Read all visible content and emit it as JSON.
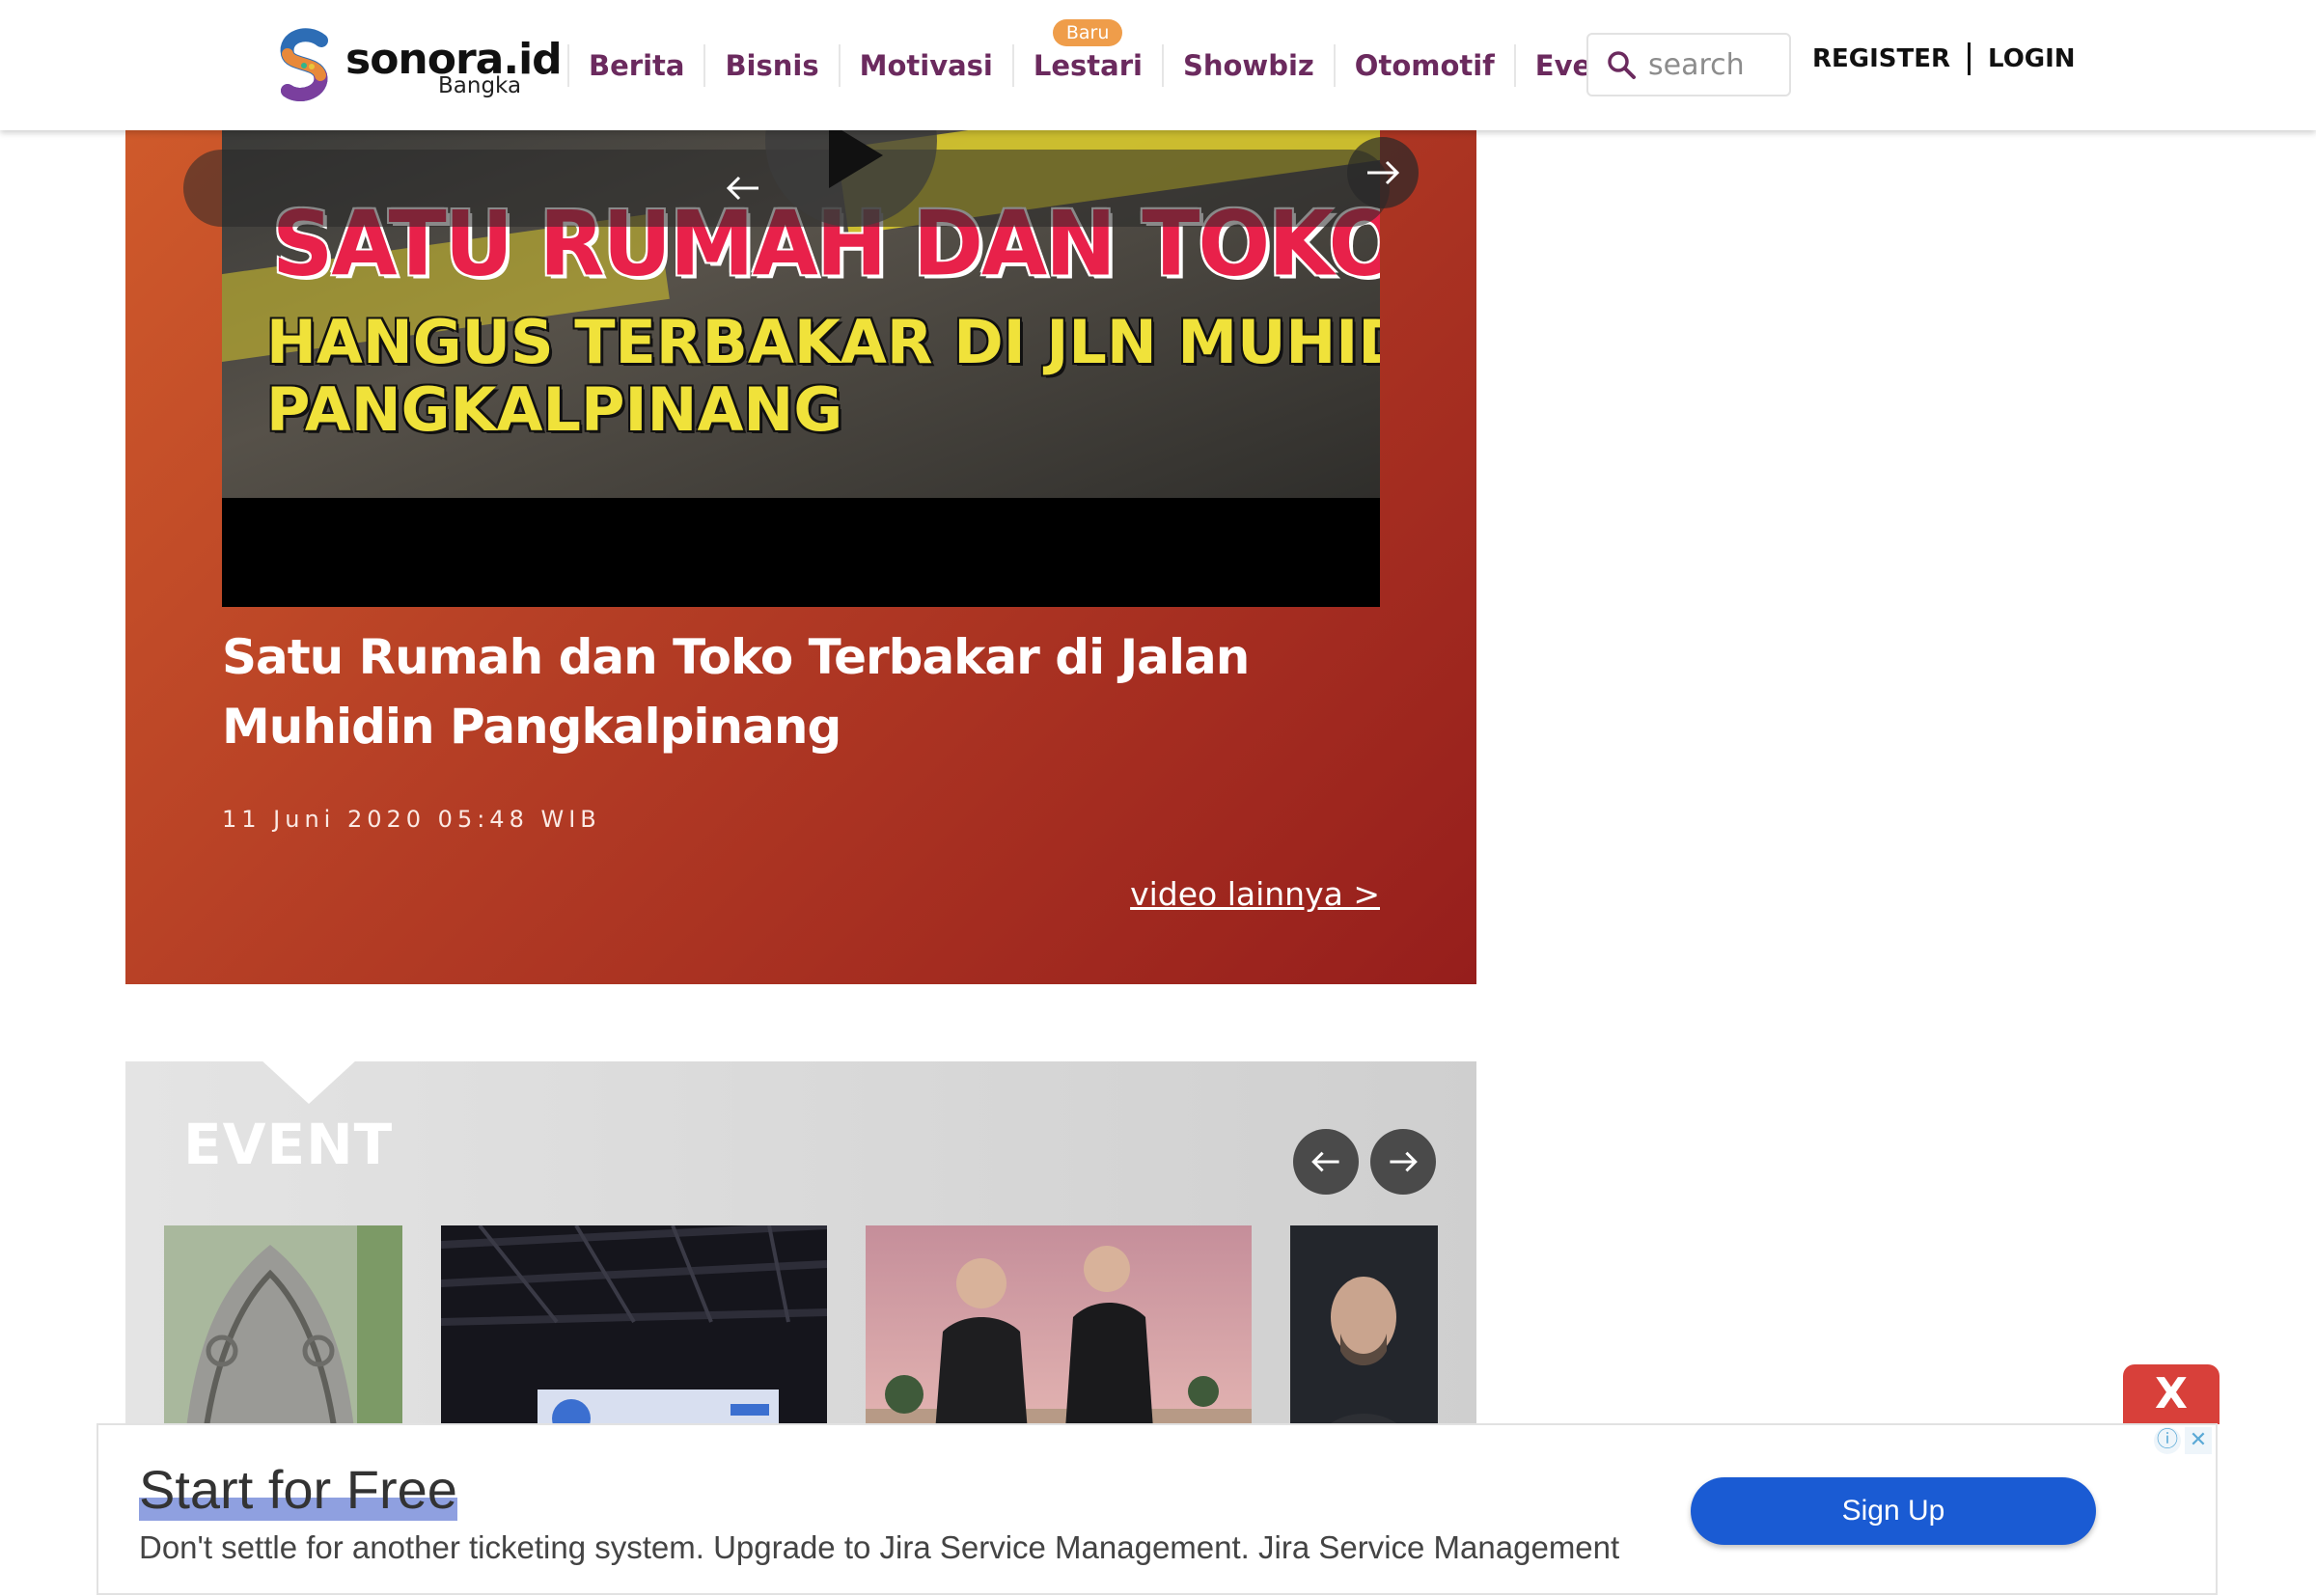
{
  "header": {
    "logo_text": "sonora.id",
    "logo_sub": "Bangka",
    "nav": [
      {
        "label": "Berita"
      },
      {
        "label": "Bisnis"
      },
      {
        "label": "Motivasi"
      },
      {
        "label": "Lestari",
        "badge": "Baru"
      },
      {
        "label": "Showbiz"
      },
      {
        "label": "Otomotif"
      },
      {
        "label": "Events"
      }
    ],
    "search_placeholder": "search",
    "register_label": "REGISTER",
    "login_label": "LOGIN"
  },
  "video": {
    "thumb_line1": "SATU RUMAH DAN TOKO",
    "thumb_line2": "HANGUS TERBAKAR DI JLN MUHIDIN",
    "thumb_line3": "PANGKALPINANG",
    "title": "Satu Rumah dan Toko Terbakar di Jalan Muhidin Pangkalpinang",
    "date": "11 Juni 2020 05:48 WIB",
    "more_label": "video lainnya >"
  },
  "event": {
    "title": "EVENT"
  },
  "ad": {
    "close_label": "X",
    "headline": "Start for Free",
    "body": "Don't settle for another ticketing system. Upgrade to Jira Service Management. Jira Service Management",
    "cta_label": "Sign Up"
  },
  "colors": {
    "brand_purple": "#6b2a5e",
    "badge_orange": "#ef9d4a",
    "video_bg": "#b43d25",
    "ad_cta": "#1a5bd3",
    "ad_close": "#d8403a"
  },
  "icons": [
    "search-icon",
    "play-icon",
    "arrow-left-icon",
    "arrow-right-icon",
    "info-icon",
    "close-icon"
  ]
}
